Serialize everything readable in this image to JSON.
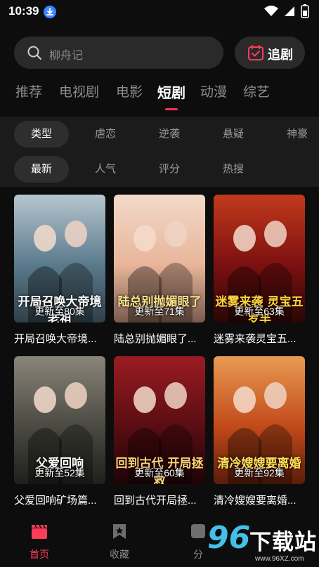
{
  "status_bar": {
    "time": "10:39"
  },
  "search": {
    "placeholder": "柳舟记"
  },
  "follow": {
    "label": "追剧"
  },
  "tabs": [
    {
      "label": "推荐",
      "active": false
    },
    {
      "label": "电视剧",
      "active": false
    },
    {
      "label": "电影",
      "active": false
    },
    {
      "label": "短剧",
      "active": true
    },
    {
      "label": "动漫",
      "active": false
    },
    {
      "label": "综艺",
      "active": false
    }
  ],
  "filters": {
    "genre": [
      "类型",
      "虐恋",
      "逆袭",
      "悬疑",
      "神豪"
    ],
    "sort": [
      "最新",
      "人气",
      "评分",
      "热搜"
    ]
  },
  "cards": [
    {
      "title": "开局召唤大帝境...",
      "episode": "更新至80集",
      "art_text": "开局召唤大帝境老祖",
      "colors": [
        "#5a7a8c",
        "#b7c6cf",
        "#2f3f48"
      ],
      "art_color": "#ffffff"
    },
    {
      "title": "陆总别抛媚眼了...",
      "episode": "更新至71集",
      "art_text": "陆总别抛媚眼了",
      "colors": [
        "#e8b59a",
        "#f3d9c9",
        "#7a5a4c"
      ],
      "art_color": "#f7e38a"
    },
    {
      "title": "迷雾来袭灵宝五...",
      "episode": "更新至63集",
      "art_text": "迷雾来袭 灵宝五岁半",
      "colors": [
        "#7d1010",
        "#c23a1c",
        "#2a0606"
      ],
      "art_color": "#ffd23b"
    },
    {
      "title": "父爱回响矿场篇...",
      "episode": "更新至52集",
      "art_text": "父爱回响",
      "colors": [
        "#4a4a42",
        "#8a857a",
        "#1f1f1c"
      ],
      "art_color": "#ffffff"
    },
    {
      "title": "回到古代开局拯...",
      "episode": "更新至60集",
      "art_text": "回到古代 开局拯救",
      "colors": [
        "#5a0d12",
        "#9a1c22",
        "#1e0406"
      ],
      "art_color": "#ffd27a"
    },
    {
      "title": "清冷嫂嫂要离婚...",
      "episode": "更新至92集",
      "art_text": "清冷嫂嫂要离婚",
      "colors": [
        "#c24a1a",
        "#e89a52",
        "#5a1c08"
      ],
      "art_color": "#ffe35a"
    }
  ],
  "bottom_nav": [
    {
      "label": "首页",
      "active": true
    },
    {
      "label": "收藏",
      "active": false
    },
    {
      "label": "分",
      "active": false
    }
  ],
  "watermark": {
    "logo": "96",
    "text": "下载站",
    "url": "www.96XZ.com"
  },
  "theme": {
    "accent": "#ff2d55",
    "background": "#0d0d0d",
    "panel": "#1b1b1b"
  }
}
